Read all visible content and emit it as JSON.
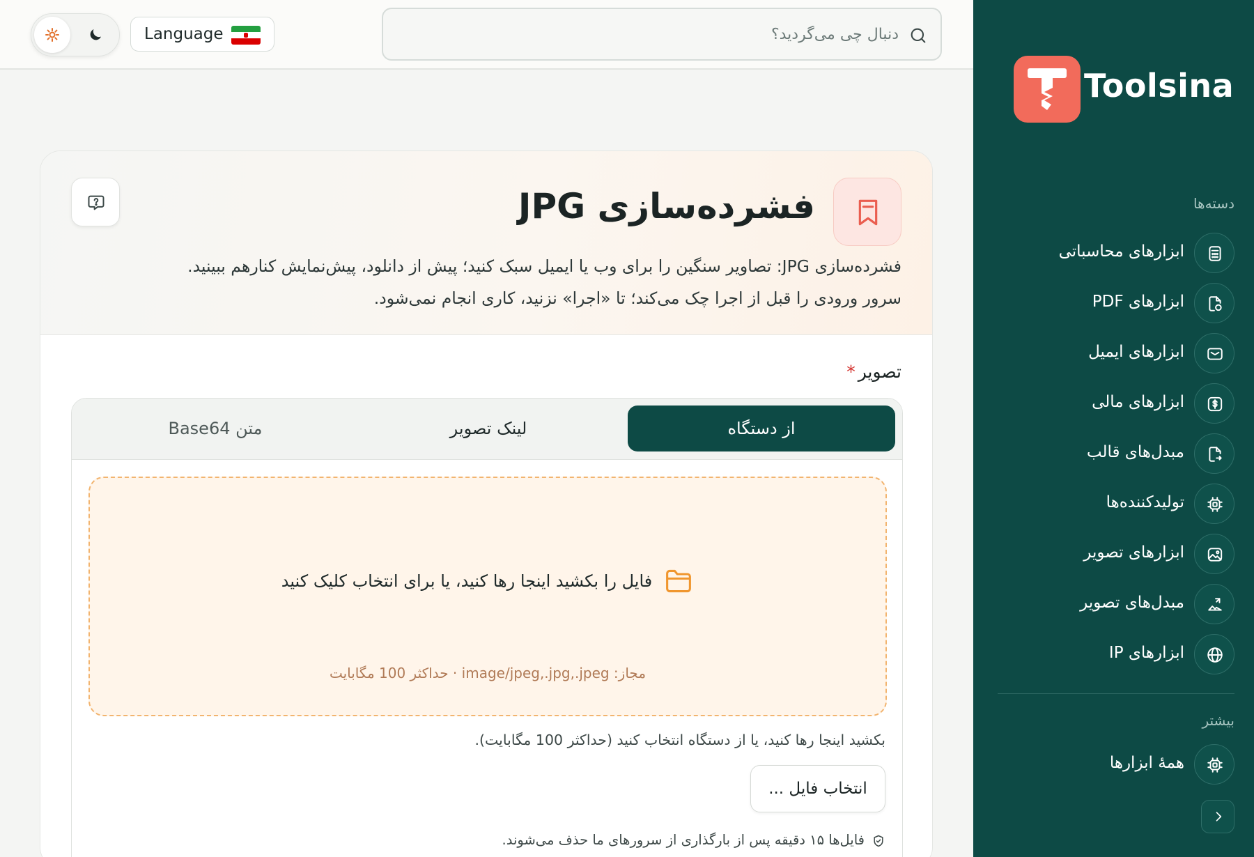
{
  "brand": {
    "name": "Toolsina",
    "accent": "#f26b5b",
    "sidebar_bg": "#0d4a45"
  },
  "topbar": {
    "search_placeholder": "دنبال چی می‌گردید؟",
    "language_label": "Language",
    "flag": "iran-flag",
    "theme_options": [
      "sun-icon",
      "moon-icon"
    ]
  },
  "sidebar": {
    "categories_title": "دسته‌ها",
    "items": [
      {
        "label": "ابزارهای محاسباتی",
        "icon": "calculator-icon"
      },
      {
        "label": "ابزارهای PDF",
        "icon": "pdf-file-icon"
      },
      {
        "label": "ابزارهای ایمیل",
        "icon": "mail-icon"
      },
      {
        "label": "ابزارهای مالی",
        "icon": "dollar-icon"
      },
      {
        "label": "مبدل‌های قالب",
        "icon": "file-convert-icon"
      },
      {
        "label": "تولیدکننده‌ها",
        "icon": "chip-icon"
      },
      {
        "label": "ابزارهای تصویر",
        "icon": "image-icon"
      },
      {
        "label": "مبدل‌های تصویر",
        "icon": "image-convert-icon"
      },
      {
        "label": "ابزارهای IP",
        "icon": "globe-icon"
      }
    ],
    "more_title": "بیشتر",
    "more_items": [
      {
        "label": "همهٔ ابزارها",
        "icon": "chip-icon"
      }
    ]
  },
  "tool": {
    "title": "فشرده‌سازی JPG",
    "description_line1": "فشرده‌سازی JPG: تصاویر سنگین را برای وب یا ایمیل سبک کنید؛ پیش از دانلود، پیش‌نمایش کنارهم ببینید.",
    "description_line2": "سرور ورودی را قبل از اجرا چک می‌کند؛ تا «اجرا» نزنید، کاری انجام نمی‌شود.",
    "field_label": "تصویر",
    "required_mark": "*",
    "tabs": [
      {
        "label": "از دستگاه",
        "active": true
      },
      {
        "label": "لینک تصویر",
        "active": false
      },
      {
        "label": "متن Base64",
        "active": false
      }
    ],
    "dropzone_text": "فایل را بکشید اینجا رها کنید، یا برای انتخاب کلیک کنید",
    "dropzone_hint": "مجاز: image/jpeg,.jpg,.jpeg · حداکثر 100 مگابایت",
    "help_text": "بکشید اینجا رها کنید، یا از دستگاه انتخاب کنید (حداکثر 100 مگابایت).",
    "pick_button": "انتخاب فایل ...",
    "privacy_note": "فایل‌ها ۱۵ دقیقه پس از بارگذاری از سرورهای ما حذف می‌شوند."
  }
}
